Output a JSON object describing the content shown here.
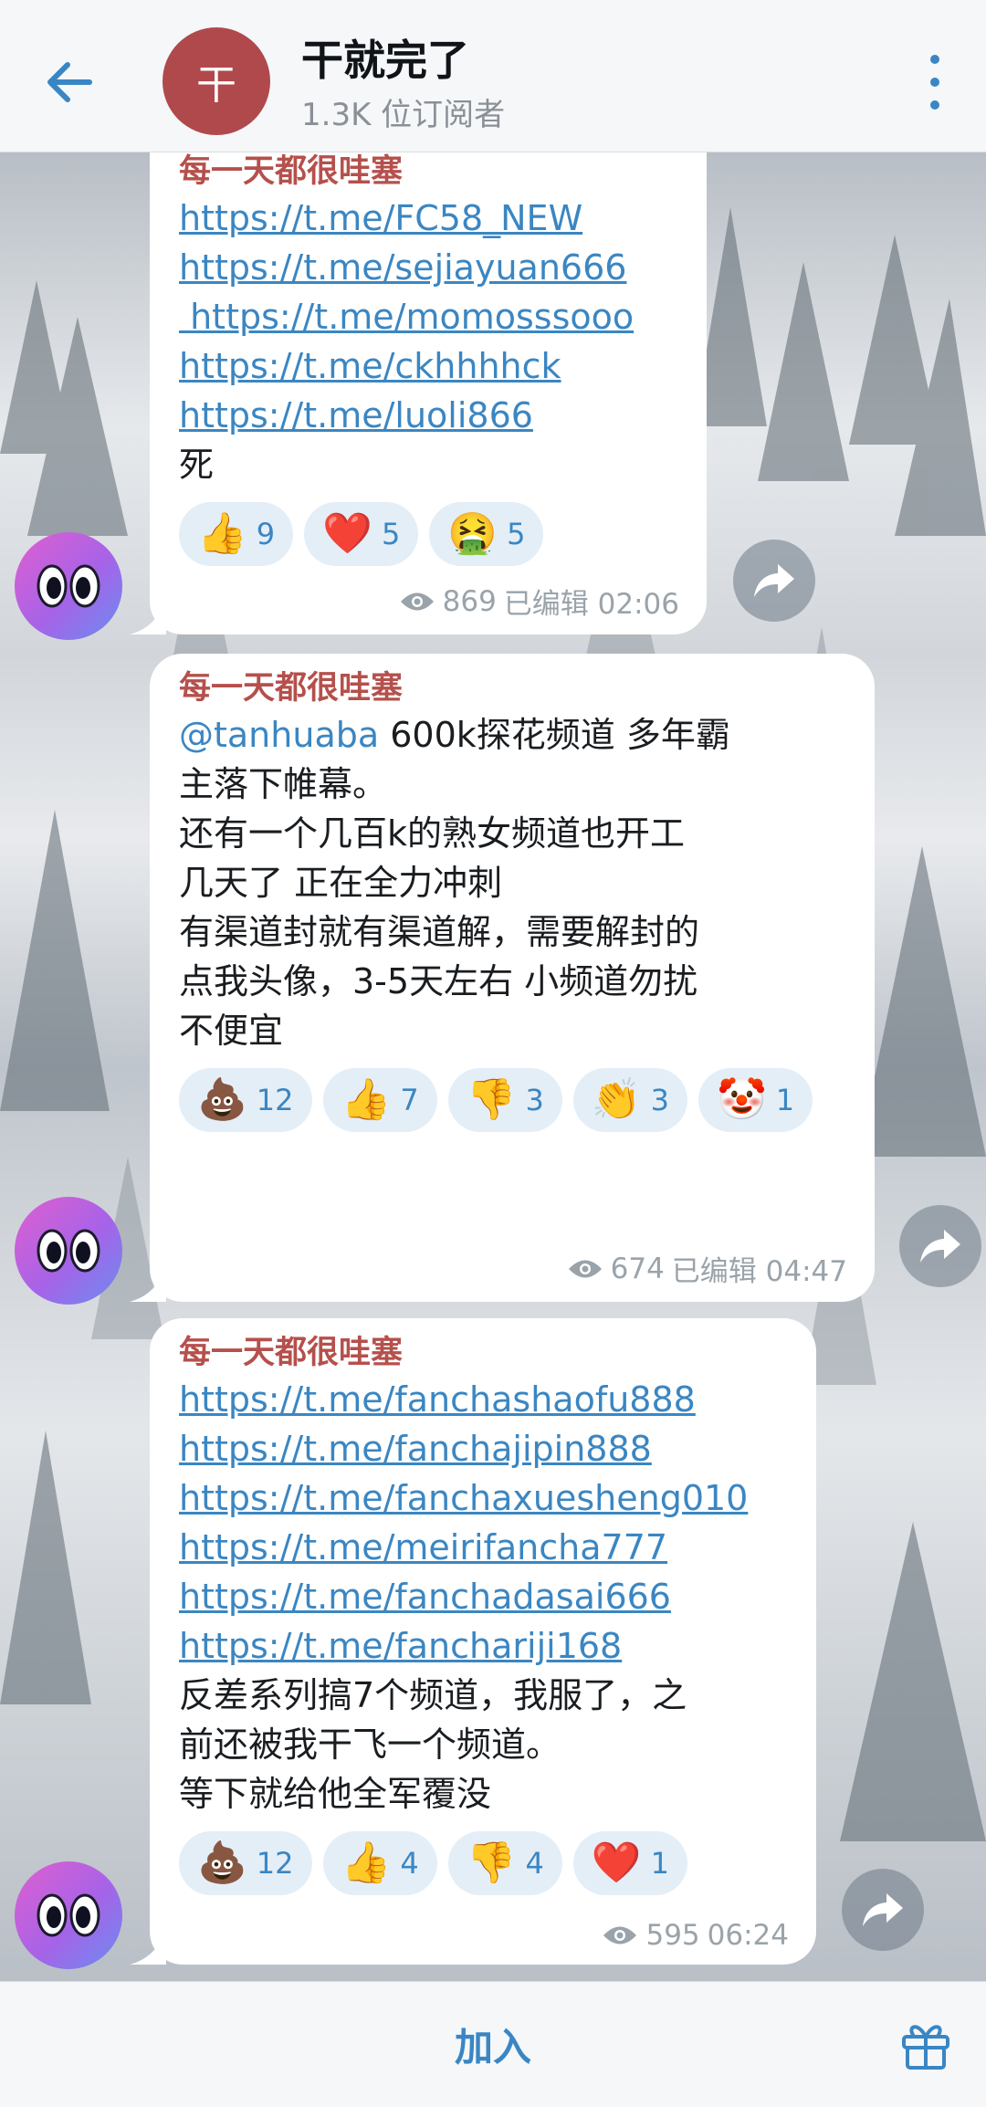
{
  "header": {
    "avatar_letter": "干",
    "title": "干就完了",
    "subtitle": "1.3K 位订阅者"
  },
  "messages": [
    {
      "sender": "每一天都很哇塞",
      "links": [
        "https://t.me/FC58_NEW",
        "https://t.me/sejiayuan666",
        " https://t.me/momosssooo",
        "https://t.me/ckhhhhck",
        "https://t.me/luoli866"
      ],
      "text": [
        "死"
      ],
      "reactions": [
        {
          "emoji": "👍",
          "count": "9"
        },
        {
          "emoji": "❤️",
          "count": "5"
        },
        {
          "emoji": "🤮",
          "count": "5"
        }
      ],
      "views": "869",
      "edited_time": "已编辑 02:06"
    },
    {
      "sender": "每一天都很哇塞",
      "mention": "@tanhuaba",
      "text": [
        " 600k探花频道 多年霸",
        "主落下帷幕。",
        "",
        "还有一个几百k的熟女频道也开工",
        "几天了 正在全力冲刺",
        "",
        "有渠道封就有渠道解，需要解封的",
        "点我头像，3-5天左右 小频道勿扰",
        "不便宜"
      ],
      "reactions": [
        {
          "emoji": "💩",
          "count": "12"
        },
        {
          "emoji": "👍",
          "count": "7"
        },
        {
          "emoji": "👎",
          "count": "3"
        },
        {
          "emoji": "👏",
          "count": "3"
        },
        {
          "emoji": "🤡",
          "count": "1"
        }
      ],
      "views": "674",
      "edited_time": "已编辑 04:47"
    },
    {
      "sender": "每一天都很哇塞",
      "links": [
        "https://t.me/fanchashaofu888",
        "https://t.me/fanchajipin888",
        "https://t.me/fanchaxuesheng010",
        "https://t.me/meirifancha777",
        "https://t.me/fanchadasai666",
        "https://t.me/fanchariji168"
      ],
      "text": [
        "反差系列搞7个频道，我服了，之",
        "前还被我干飞一个频道。",
        "等下就给他全军覆没"
      ],
      "reactions": [
        {
          "emoji": "💩",
          "count": "12"
        },
        {
          "emoji": "👍",
          "count": "4"
        },
        {
          "emoji": "👎",
          "count": "4"
        },
        {
          "emoji": "❤️",
          "count": "1"
        }
      ],
      "views": "595",
      "edited_time": "06:24"
    }
  ],
  "bottom": {
    "join_label": "加入"
  },
  "colors": {
    "accent": "#3a86c4",
    "sender_name": "#b5504c",
    "channel_avatar": "#b0494c"
  },
  "icons": [
    "back-arrow-icon",
    "more-vert-icon",
    "eye-icon",
    "share-arrow-icon",
    "gift-icon"
  ]
}
